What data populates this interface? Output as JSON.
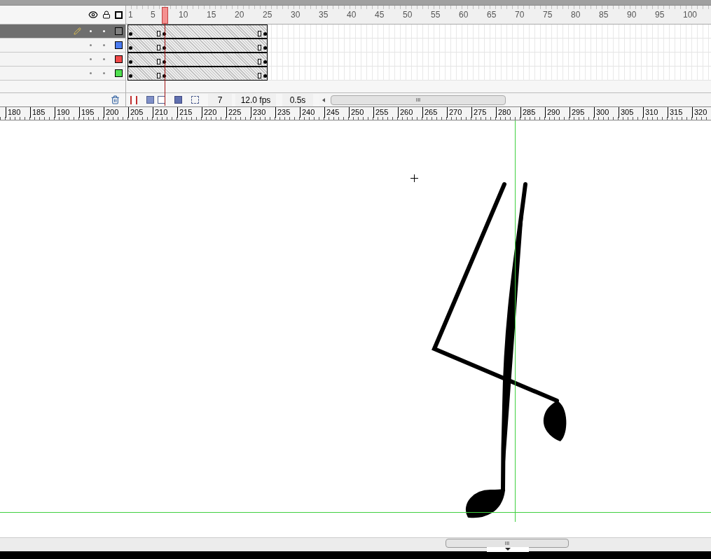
{
  "timeline": {
    "frame_labels": [
      "1",
      "5",
      "10",
      "15",
      "20",
      "25",
      "30",
      "35",
      "40",
      "45",
      "50",
      "55",
      "60",
      "65",
      "70",
      "75",
      "80",
      "85",
      "90",
      "95",
      "100"
    ],
    "layers": [
      {
        "selected": true,
        "editing": true,
        "color": "#808080"
      },
      {
        "selected": false,
        "editing": false,
        "color": "#4a7bf0"
      },
      {
        "selected": false,
        "editing": false,
        "color": "#f04848"
      },
      {
        "selected": false,
        "editing": false,
        "color": "#50e050"
      }
    ],
    "current_frame": "7",
    "frame_rate": "12.0 fps",
    "elapsed_time": "0.5s",
    "scroll_grip": "III"
  },
  "ruler": {
    "labels": [
      "180",
      "185",
      "190",
      "195",
      "200",
      "205",
      "210",
      "215",
      "220",
      "225",
      "230",
      "235",
      "240",
      "245",
      "250",
      "255",
      "260",
      "265",
      "270",
      "275",
      "280",
      "285",
      "290",
      "295",
      "300",
      "305",
      "310",
      "315",
      "320"
    ]
  },
  "stage": {
    "scroll_grip": "III"
  }
}
